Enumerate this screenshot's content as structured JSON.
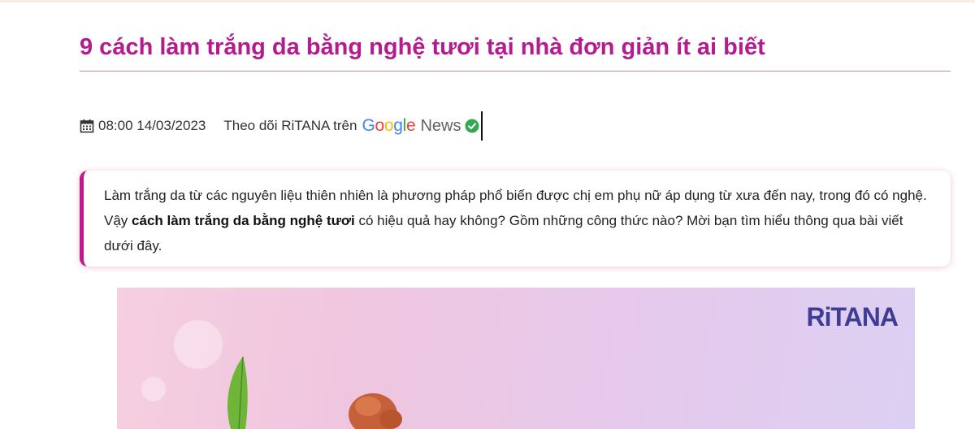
{
  "article": {
    "title": "9 cách làm trắng da bằng nghệ tươi tại nhà đơn giản ít ai biết",
    "meta": {
      "datetime": "08:00 14/03/2023",
      "follow_text": "Theo dõi RiTANA trên",
      "google_letters": [
        "G",
        "o",
        "o",
        "g",
        "l",
        "e"
      ],
      "news_word": "News"
    },
    "sapo": {
      "before": "Làm trắng da từ các nguyên liệu thiên nhiên là phương pháp phổ biến được chị em phụ nữ áp dụng từ xưa đến nay, trong đó có nghệ. Vậy ",
      "bold": "cách làm trắng da bằng nghệ tươi",
      "after": " có hiệu quả hay không? Gồm những công thức nào? Mời bạn tìm hiểu thông qua bài viết dưới đây."
    },
    "hero_image": {
      "brand": "RiTANA"
    }
  },
  "icons": {
    "calendar": "calendar-icon",
    "check": "check-circle-icon"
  },
  "colors": {
    "title": "#b41b8e",
    "accent_border": "#c0188f",
    "rule": "#b983c0",
    "brand": "#3e3d96",
    "check_green": "#34a853"
  }
}
